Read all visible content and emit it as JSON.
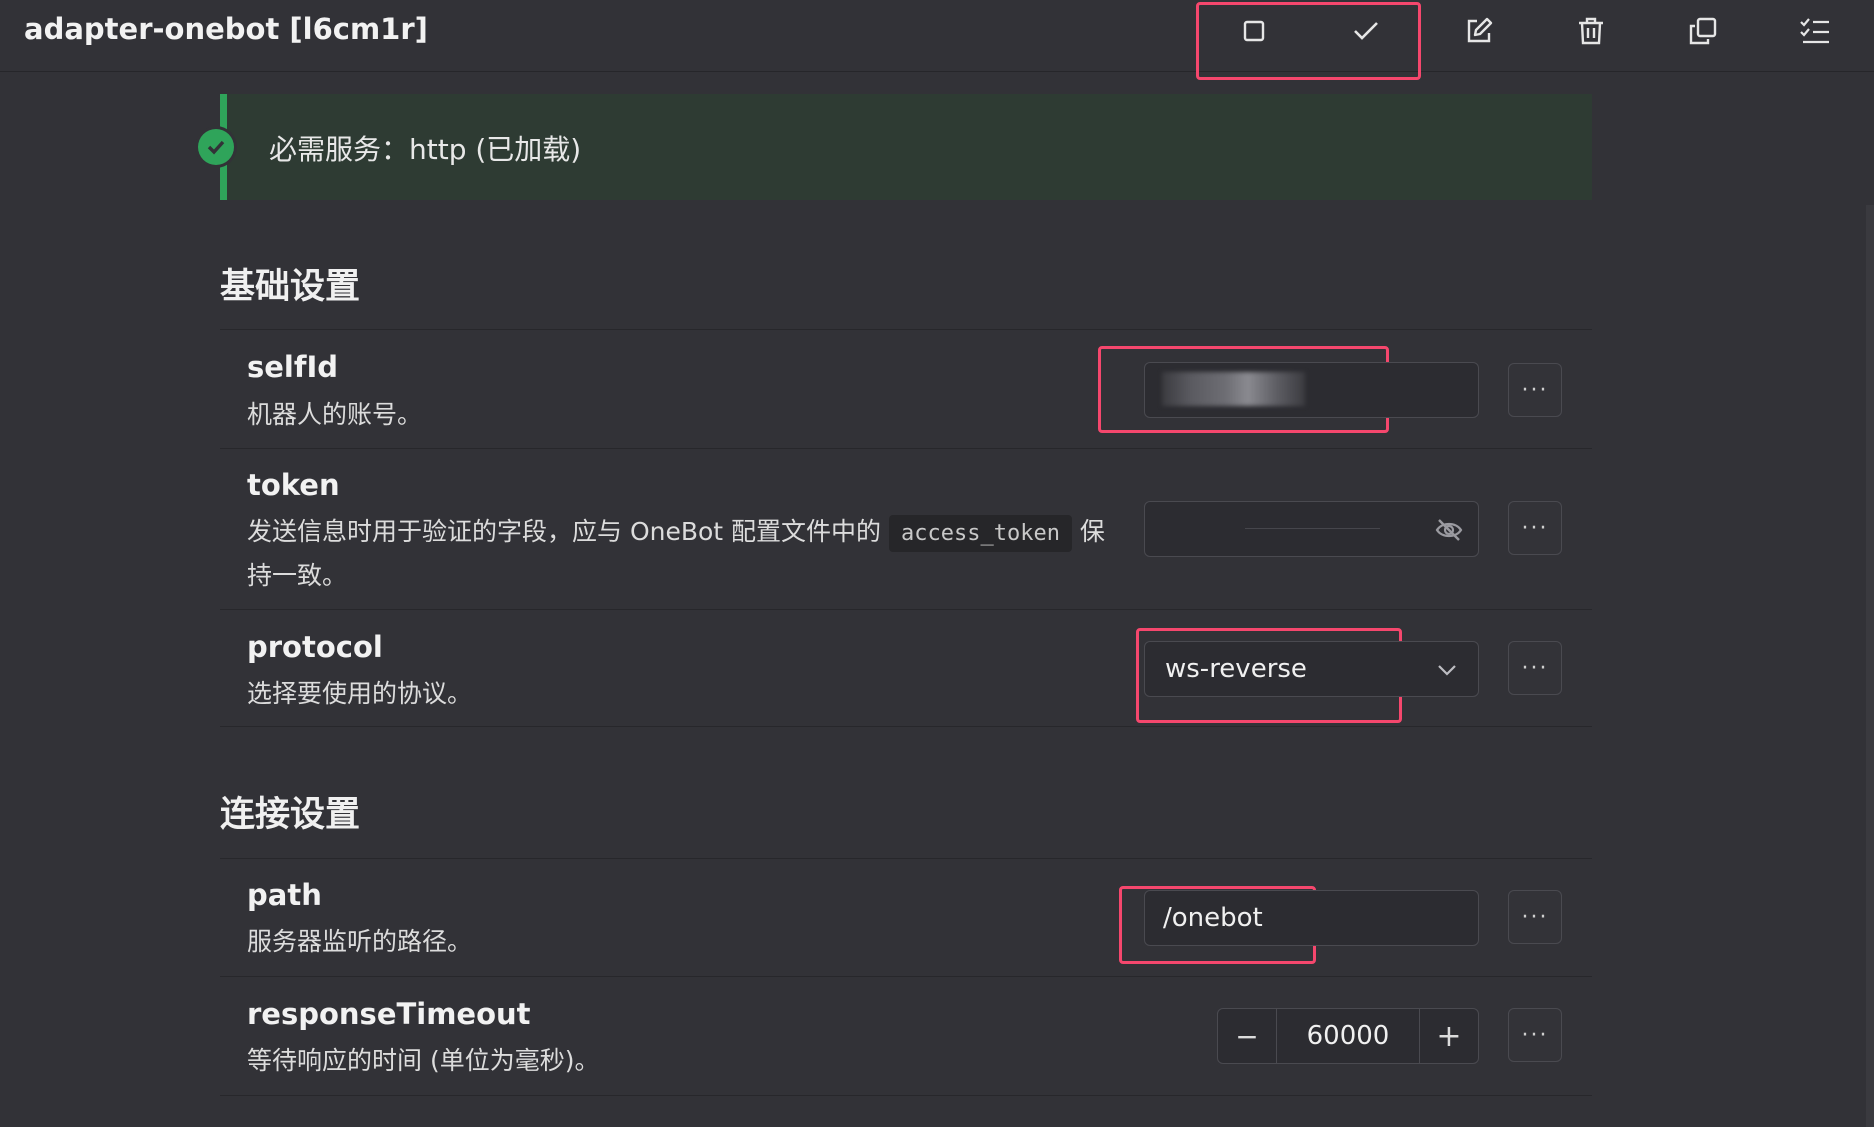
{
  "header": {
    "title": "adapter-onebot [l6cm1r]",
    "buttons": [
      "stop",
      "confirm",
      "edit",
      "delete",
      "copy",
      "checklist"
    ]
  },
  "banner": {
    "text": "必需服务：http (已加载)",
    "status_color": "#2fa45a"
  },
  "sections": {
    "basic": {
      "title": "基础设置"
    },
    "connection": {
      "title": "连接设置"
    }
  },
  "items": {
    "selfId": {
      "name": "selfId",
      "desc": "机器人的账号。"
    },
    "token": {
      "name": "token",
      "desc_before": "发送信息时用于验证的字段，应与 OneBot 配置文件中的",
      "code": "access_token",
      "desc_after_inline": "保",
      "desc_line2": "持一致。"
    },
    "protocol": {
      "name": "protocol",
      "desc": "选择要使用的协议。",
      "value": "ws-reverse"
    },
    "path": {
      "name": "path",
      "desc": "服务器监听的路径。",
      "value": "/onebot"
    },
    "responseTimeout": {
      "name": "responseTimeout",
      "desc": "等待响应的时间 (单位为毫秒)。",
      "value": "60000",
      "minus": "−",
      "plus": "+"
    }
  },
  "more_label": "···",
  "accent_color": "#f5476d"
}
